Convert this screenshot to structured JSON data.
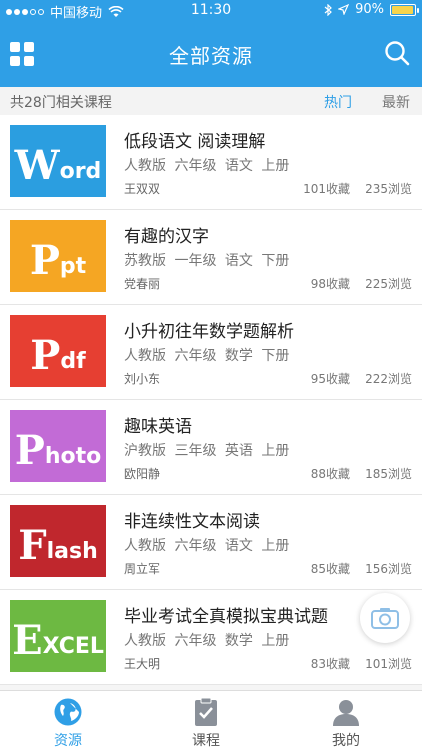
{
  "status": {
    "carrier": "中国移动",
    "time": "11:30",
    "battery": "90%"
  },
  "header": {
    "title": "全部资源",
    "menu_icon": "grid-icon",
    "search_icon": "search-icon",
    "color": "#2f9fe6"
  },
  "subbar": {
    "count": "共28门相关课程",
    "hot": "热门",
    "latest": "最新"
  },
  "items": [
    {
      "label": "Word",
      "big": "W",
      "rest": "ord",
      "color": "#2b9ee0",
      "name": "低段语文 阅读理解",
      "meta": "人教版 六年级 语文 上册",
      "author": "王双双",
      "fav": "101收藏",
      "views": "235浏览"
    },
    {
      "label": "Ppt",
      "big": "P",
      "rest": "pt",
      "color": "#f5a623",
      "name": "有趣的汉字",
      "meta": "苏教版 一年级 语文 下册",
      "author": "党春丽",
      "fav": "98收藏",
      "views": "225浏览"
    },
    {
      "label": "Pdf",
      "big": "P",
      "rest": "df",
      "color": "#e63f32",
      "name": "小升初往年数学题解析",
      "meta": "人教版 六年级 数学 下册",
      "author": "刘小东",
      "fav": "95收藏",
      "views": "222浏览"
    },
    {
      "label": "Photo",
      "big": "P",
      "rest": "hoto",
      "color": "#c26bd6",
      "name": "趣味英语",
      "meta": "沪教版 三年级 英语 上册",
      "author": "欧阳静",
      "fav": "88收藏",
      "views": "185浏览"
    },
    {
      "label": "Flash",
      "big": "F",
      "rest": "lash",
      "color": "#c0272d",
      "name": "非连续性文本阅读",
      "meta": "人教版 六年级 语文 上册",
      "author": "周立军",
      "fav": "85收藏",
      "views": "156浏览"
    },
    {
      "label": "EXCEL",
      "big": "E",
      "rest": "XCEL",
      "color": "#6db942",
      "name": "毕业考试全真模拟宝典试题",
      "meta": "人教版 六年级 数学 上册",
      "author": "王大明",
      "fav": "83收藏",
      "views": "101浏览"
    }
  ],
  "tabs": [
    {
      "label": "资源",
      "icon": "globe-icon",
      "active": true
    },
    {
      "label": "课程",
      "icon": "clipboard-icon",
      "active": false
    },
    {
      "label": "我的",
      "icon": "user-icon",
      "active": false
    }
  ],
  "fab": {
    "icon": "camera-icon"
  }
}
